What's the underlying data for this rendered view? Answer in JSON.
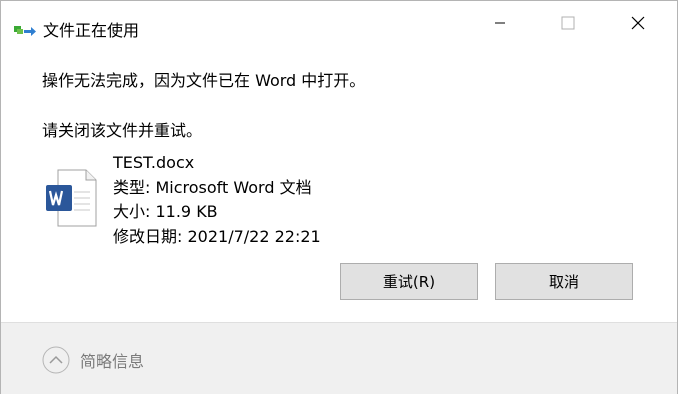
{
  "window": {
    "title": "文件正在使用",
    "icon": "file-move-icon",
    "controls": [
      "minimize-icon",
      "maximize-icon",
      "close-icon"
    ]
  },
  "message": {
    "line1": "操作无法完成，因为文件已在 Word 中打开。",
    "line2": "请关闭该文件并重试。"
  },
  "file": {
    "icon": "word-document-icon",
    "name": "TEST.docx",
    "type": "类型: Microsoft Word 文档",
    "size": "大小: 11.9 KB",
    "modified": "修改日期: 2021/7/22 22:21"
  },
  "buttons": {
    "retry": "重试(R)",
    "cancel": "取消"
  },
  "footer": {
    "details_label": "简略信息",
    "toggle_icon": "chevron-up-icon"
  },
  "colors": {
    "word_blue": "#2b579a",
    "button_face": "#e1e1e1",
    "footer_bg": "#f0f0f0"
  }
}
